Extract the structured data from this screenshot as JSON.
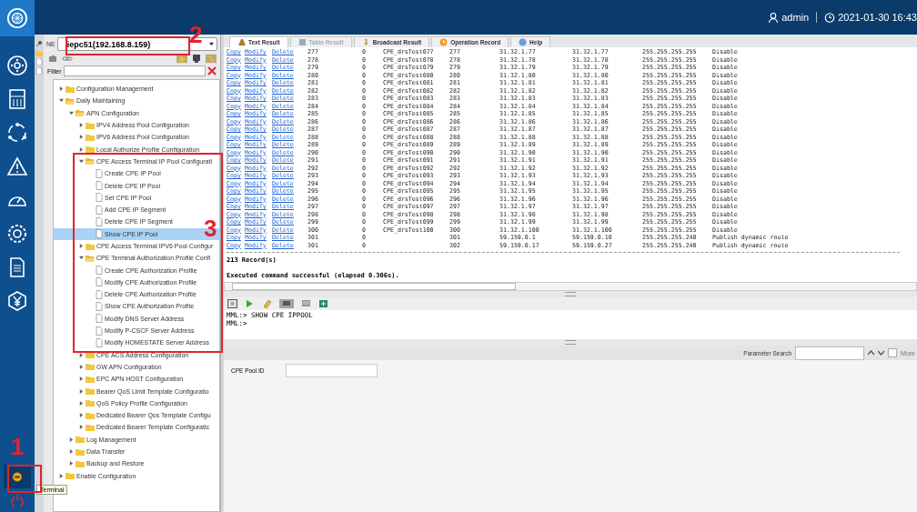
{
  "header": {
    "user": "admin",
    "datetime": "2021-01-30 16:43"
  },
  "rail": {
    "items": [
      {
        "kind": "nodes"
      },
      {
        "kind": "calculator"
      },
      {
        "kind": "cycle"
      },
      {
        "kind": "warning"
      },
      {
        "kind": "gauge"
      },
      {
        "kind": "gear"
      },
      {
        "kind": "document"
      },
      {
        "kind": "yen"
      }
    ],
    "terminal": {
      "selected": true,
      "tooltip": "Terminal"
    }
  },
  "ne_selector": {
    "label": "NE",
    "value": "iepc51(192.168.8.159)"
  },
  "filter": {
    "label": "Filter"
  },
  "tree": [
    {
      "label": "Configuration Management",
      "kind": "folder",
      "expanded": false,
      "selected": false
    },
    {
      "label": "Daily Maintaining",
      "kind": "folder",
      "expanded": true,
      "selected": false,
      "children": [
        {
          "label": "APN Configuration",
          "kind": "folder",
          "expanded": true,
          "selected": false,
          "children": [
            {
              "label": "IPV4 Address Pool Configuration",
              "kind": "folder",
              "expanded": false,
              "selected": false
            },
            {
              "label": "IPV6 Address Pool Configuration",
              "kind": "folder",
              "expanded": false,
              "selected": false
            },
            {
              "label": "Local Authorize Profile Configuration",
              "kind": "folder",
              "expanded": false,
              "selected": false
            },
            {
              "label": "CPE Access Terminal IP Pool Configurati",
              "kind": "folder",
              "expanded": true,
              "selected": false,
              "children": [
                {
                  "label": "Create CPE IP Pool",
                  "kind": "command",
                  "selected": false
                },
                {
                  "label": "Delete CPE IP Pool",
                  "kind": "command",
                  "selected": false
                },
                {
                  "label": "Set CPE IP Pool",
                  "kind": "command",
                  "selected": false
                },
                {
                  "label": "Add CPE IP Segment",
                  "kind": "command",
                  "selected": false
                },
                {
                  "label": "Delete CPE IP Segment",
                  "kind": "command",
                  "selected": false
                },
                {
                  "label": "Show CPE IP Pool",
                  "kind": "command",
                  "selected": true
                }
              ]
            },
            {
              "label": "CPE Access Terminal IPV6 Pool Configur",
              "kind": "folder",
              "expanded": false,
              "selected": false
            },
            {
              "label": "CPE Terminal Authorization Profile Confi",
              "kind": "folder",
              "expanded": true,
              "selected": false,
              "children": [
                {
                  "label": "Create CPE Authorization Profile",
                  "kind": "command",
                  "selected": false
                },
                {
                  "label": "Modify CPE Authorization Profile",
                  "kind": "command",
                  "selected": false
                },
                {
                  "label": "Delete CPE Authorization Profile",
                  "kind": "command",
                  "selected": false
                },
                {
                  "label": "Show CPE Authorization Profile",
                  "kind": "command",
                  "selected": false
                },
                {
                  "label": "Modify DNS Server Address",
                  "kind": "command",
                  "selected": false
                },
                {
                  "label": "Modify P-CSCF Server Address",
                  "kind": "command",
                  "selected": false
                },
                {
                  "label": "Modify HOMESTATE Server Address",
                  "kind": "command",
                  "selected": false
                }
              ]
            },
            {
              "label": "CPE ACS Address Configuration",
              "kind": "folder",
              "expanded": false,
              "selected": false
            },
            {
              "label": "GW APN Configuration",
              "kind": "folder",
              "expanded": false,
              "selected": false
            },
            {
              "label": "EPC APN HOST Configuration",
              "kind": "folder",
              "expanded": false,
              "selected": false
            },
            {
              "label": "Bearer QoS Limit Template Configuratio",
              "kind": "folder",
              "expanded": false,
              "selected": false
            },
            {
              "label": "QoS Policy Profile Configuration",
              "kind": "folder",
              "expanded": false,
              "selected": false
            },
            {
              "label": "Dedicated Bearer Qos Template Configu",
              "kind": "folder",
              "expanded": false,
              "selected": false
            },
            {
              "label": "Dedicated Bearer Template Configuratic",
              "kind": "folder",
              "expanded": false,
              "selected": false
            }
          ]
        },
        {
          "label": "Log Management",
          "kind": "folder",
          "expanded": false,
          "selected": false
        },
        {
          "label": "Data Transfer",
          "kind": "folder",
          "expanded": false,
          "selected": false
        },
        {
          "label": "Backup and Restore",
          "kind": "folder",
          "expanded": false,
          "selected": false
        }
      ]
    },
    {
      "label": "Enable Configuration",
      "kind": "folder",
      "expanded": false,
      "selected": false
    }
  ],
  "tabs": [
    {
      "label": "Text Result",
      "selected": true,
      "disabled": false
    },
    {
      "label": "Table Result",
      "selected": false,
      "disabled": true
    },
    {
      "label": "Broadcast Result",
      "selected": false,
      "disabled": false
    },
    {
      "label": "Operation Record",
      "selected": false,
      "disabled": false
    },
    {
      "label": "Help",
      "selected": false,
      "disabled": false
    }
  ],
  "result": {
    "rows": [
      {
        "actions": [
          "Copy",
          "Modify",
          "Delete"
        ],
        "cells": [
          "277",
          "0",
          "CPE_drsTest077",
          "277",
          "31.32.1.77",
          "31.32.1.77",
          "255.255.255.255",
          "Disable"
        ]
      },
      {
        "actions": [
          "Copy",
          "Modify",
          "Delete"
        ],
        "cells": [
          "278",
          "0",
          "CPE_drsTest078",
          "278",
          "31.32.1.78",
          "31.32.1.78",
          "255.255.255.255",
          "Disable"
        ]
      },
      {
        "actions": [
          "Copy",
          "Modify",
          "Delete"
        ],
        "cells": [
          "279",
          "0",
          "CPE_drsTest079",
          "279",
          "31.32.1.79",
          "31.32.1.79",
          "255.255.255.255",
          "Disable"
        ]
      },
      {
        "actions": [
          "Copy",
          "Modify",
          "Delete"
        ],
        "cells": [
          "280",
          "0",
          "CPE_drsTest080",
          "280",
          "31.32.1.80",
          "31.32.1.80",
          "255.255.255.255",
          "Disable"
        ]
      },
      {
        "actions": [
          "Copy",
          "Modify",
          "Delete"
        ],
        "cells": [
          "281",
          "0",
          "CPE_drsTest081",
          "281",
          "31.32.1.81",
          "31.32.1.81",
          "255.255.255.255",
          "Disable"
        ]
      },
      {
        "actions": [
          "Copy",
          "Modify",
          "Delete"
        ],
        "cells": [
          "282",
          "0",
          "CPE_drsTest082",
          "282",
          "31.32.1.82",
          "31.32.1.82",
          "255.255.255.255",
          "Disable"
        ]
      },
      {
        "actions": [
          "Copy",
          "Modify",
          "Delete"
        ],
        "cells": [
          "283",
          "0",
          "CPE_drsTest083",
          "283",
          "31.32.1.83",
          "31.32.1.83",
          "255.255.255.255",
          "Disable"
        ]
      },
      {
        "actions": [
          "Copy",
          "Modify",
          "Delete"
        ],
        "cells": [
          "284",
          "0",
          "CPE_drsTest084",
          "284",
          "31.32.1.84",
          "31.32.1.84",
          "255.255.255.255",
          "Disable"
        ]
      },
      {
        "actions": [
          "Copy",
          "Modify",
          "Delete"
        ],
        "cells": [
          "285",
          "0",
          "CPE_drsTest085",
          "285",
          "31.32.1.85",
          "31.32.1.85",
          "255.255.255.255",
          "Disable"
        ]
      },
      {
        "actions": [
          "Copy",
          "Modify",
          "Delete"
        ],
        "cells": [
          "286",
          "0",
          "CPE_drsTest086",
          "286",
          "31.32.1.86",
          "31.32.1.86",
          "255.255.255.255",
          "Disable"
        ]
      },
      {
        "actions": [
          "Copy",
          "Modify",
          "Delete"
        ],
        "cells": [
          "287",
          "0",
          "CPE_drsTest087",
          "287",
          "31.32.1.87",
          "31.32.1.87",
          "255.255.255.255",
          "Disable"
        ]
      },
      {
        "actions": [
          "Copy",
          "Modify",
          "Delete"
        ],
        "cells": [
          "288",
          "0",
          "CPE_drsTest088",
          "288",
          "31.32.1.88",
          "31.32.1.88",
          "255.255.255.255",
          "Disable"
        ]
      },
      {
        "actions": [
          "Copy",
          "Modify",
          "Delete"
        ],
        "cells": [
          "289",
          "0",
          "CPE_drsTest089",
          "289",
          "31.32.1.89",
          "31.32.1.89",
          "255.255.255.255",
          "Disable"
        ]
      },
      {
        "actions": [
          "Copy",
          "Modify",
          "Delete"
        ],
        "cells": [
          "290",
          "0",
          "CPE_drsTest090",
          "290",
          "31.32.1.90",
          "31.32.1.90",
          "255.255.255.255",
          "Disable"
        ]
      },
      {
        "actions": [
          "Copy",
          "Modify",
          "Delete"
        ],
        "cells": [
          "291",
          "0",
          "CPE_drsTest091",
          "291",
          "31.32.1.91",
          "31.32.1.91",
          "255.255.255.255",
          "Disable"
        ]
      },
      {
        "actions": [
          "Copy",
          "Modify",
          "Delete"
        ],
        "cells": [
          "292",
          "0",
          "CPE_drsTest092",
          "292",
          "31.32.1.92",
          "31.32.1.92",
          "255.255.255.255",
          "Disable"
        ]
      },
      {
        "actions": [
          "Copy",
          "Modify",
          "Delete"
        ],
        "cells": [
          "293",
          "0",
          "CPE_drsTest093",
          "293",
          "31.32.1.93",
          "31.32.1.93",
          "255.255.255.255",
          "Disable"
        ]
      },
      {
        "actions": [
          "Copy",
          "Modify",
          "Delete"
        ],
        "cells": [
          "294",
          "0",
          "CPE_drsTest094",
          "294",
          "31.32.1.94",
          "31.32.1.94",
          "255.255.255.255",
          "Disable"
        ]
      },
      {
        "actions": [
          "Copy",
          "Modify",
          "Delete"
        ],
        "cells": [
          "295",
          "0",
          "CPE_drsTest095",
          "295",
          "31.32.1.95",
          "31.32.1.95",
          "255.255.255.255",
          "Disable"
        ]
      },
      {
        "actions": [
          "Copy",
          "Modify",
          "Delete"
        ],
        "cells": [
          "296",
          "0",
          "CPE_drsTest096",
          "296",
          "31.32.1.96",
          "31.32.1.96",
          "255.255.255.255",
          "Disable"
        ]
      },
      {
        "actions": [
          "Copy",
          "Modify",
          "Delete"
        ],
        "cells": [
          "297",
          "0",
          "CPE_drsTest097",
          "297",
          "31.32.1.97",
          "31.32.1.97",
          "255.255.255.255",
          "Disable"
        ]
      },
      {
        "actions": [
          "Copy",
          "Modify",
          "Delete"
        ],
        "cells": [
          "298",
          "0",
          "CPE_drsTest098",
          "298",
          "31.32.1.98",
          "31.32.1.98",
          "255.255.255.255",
          "Disable"
        ]
      },
      {
        "actions": [
          "Copy",
          "Modify",
          "Delete"
        ],
        "cells": [
          "299",
          "0",
          "CPE_drsTest099",
          "299",
          "31.32.1.99",
          "31.32.1.99",
          "255.255.255.255",
          "Disable"
        ]
      },
      {
        "actions": [
          "Copy",
          "Modify",
          "Delete"
        ],
        "cells": [
          "300",
          "0",
          "CPE_drsTest100",
          "300",
          "31.32.1.100",
          "31.32.1.100",
          "255.255.255.255",
          "Disable"
        ]
      },
      {
        "actions": [
          "Copy",
          "Modify",
          "Delete"
        ],
        "cells": [
          "301",
          "0",
          "",
          "301",
          "59.159.0.1",
          "59.159.0.10",
          "255.255.255.240",
          "Publish dynamic route"
        ]
      },
      {
        "actions": [
          "Copy",
          "Modify",
          "Delete"
        ],
        "cells": [
          "301",
          "0",
          "",
          "302",
          "59.159.0.17",
          "59.159.0.27",
          "255.255.255.240",
          "Publish dynamic route"
        ]
      }
    ],
    "record_count": "213 Record(s)",
    "message": "Executed command successful (elapsed 0.306s)."
  },
  "console": {
    "lines": [
      "MML:> SHOW CPE IPPOOL",
      "MML:>"
    ]
  },
  "parameters": {
    "search_label": "Parameter Search",
    "more_label": "More",
    "more_checked": false,
    "fields": [
      {
        "label": "CPE Pool ID"
      }
    ]
  },
  "annotations": [
    {
      "number": "1"
    },
    {
      "number": "2"
    },
    {
      "number": "3"
    }
  ]
}
